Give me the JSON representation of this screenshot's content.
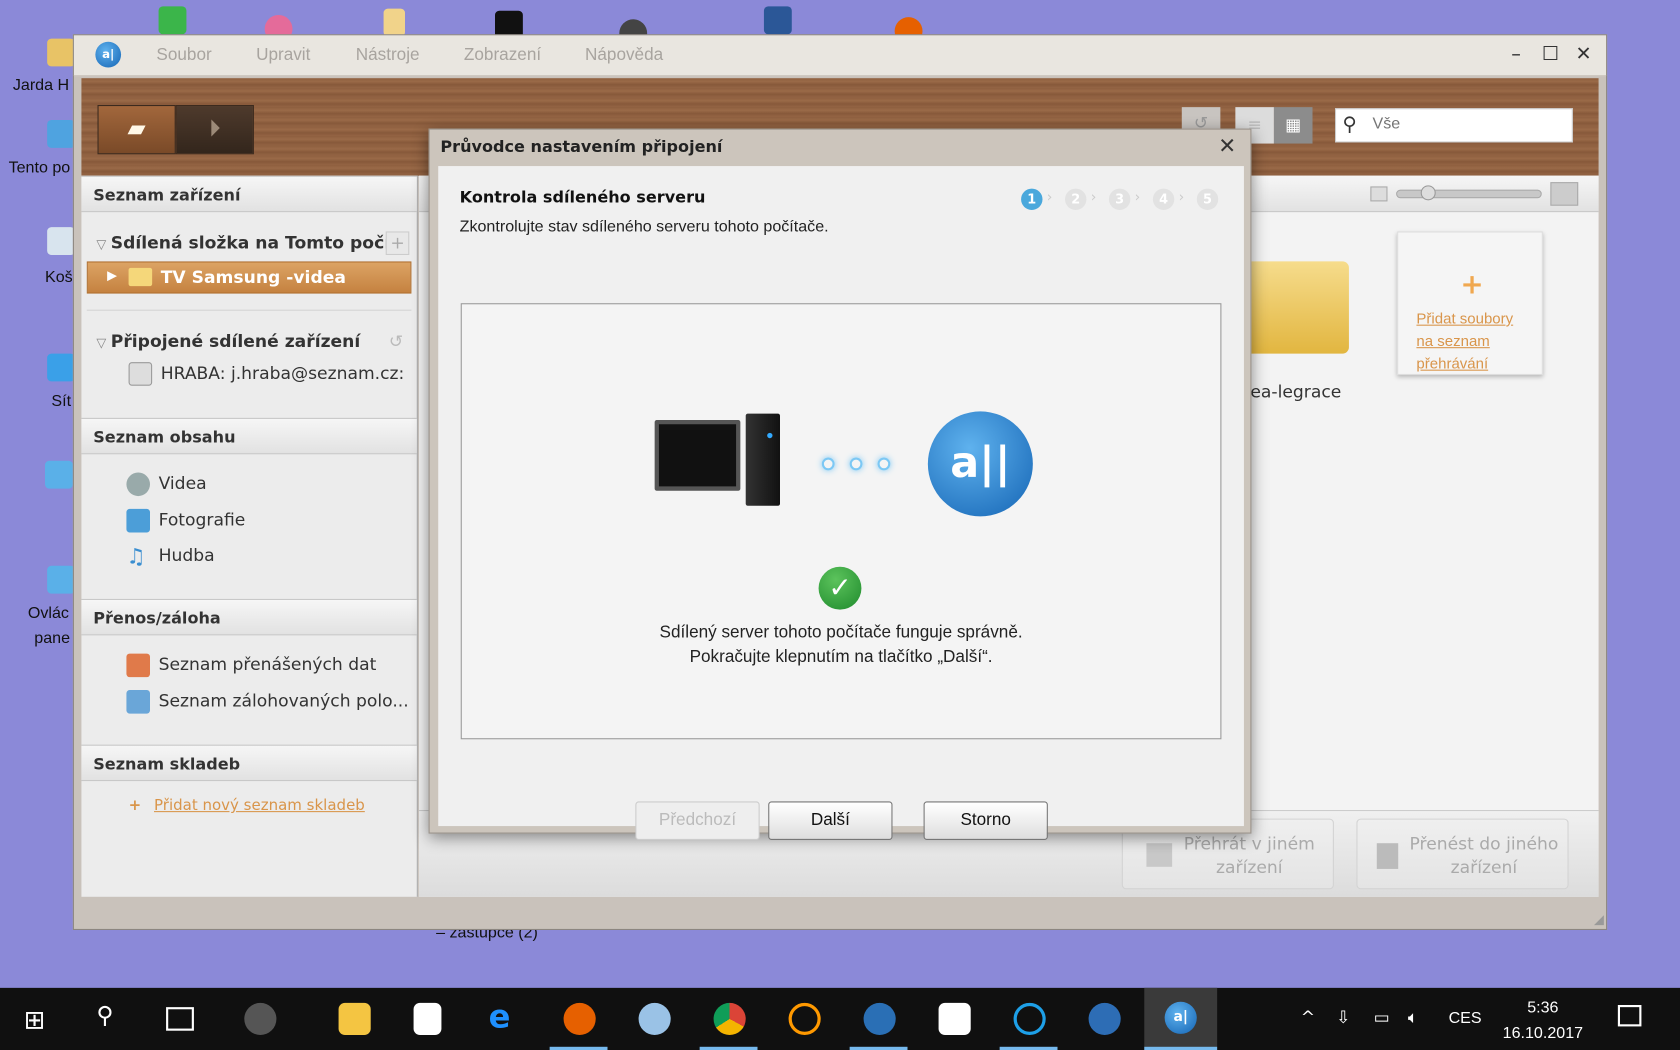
{
  "desktop": {
    "icons": [
      "Jarda H",
      "Tento po",
      "Koš",
      "Sít",
      "Ovlác",
      "pane"
    ],
    "partial_text": "– zástupce (2)"
  },
  "app": {
    "menu": [
      "Soubor",
      "Upravit",
      "Nástroje",
      "Zobrazení",
      "Nápověda"
    ],
    "search": {
      "placeholder": "Vše"
    },
    "sidebar": {
      "devices_header": "Seznam zařízení",
      "shared_folder": "Sdílená složka na Tomto počí...",
      "selected_item": "TV Samsung -videa",
      "connected": "Připojené sdílené zařízení",
      "connected_device": "HRABA: j.hraba@seznam.cz:",
      "content_header": "Seznam obsahu",
      "content_items": [
        "Videa",
        "Fotografie",
        "Hudba"
      ],
      "transfer_header": "Přenos/záloha",
      "transfer_items": [
        "Seznam přenášených dat",
        "Seznam zálohovaných polo..."
      ],
      "playlist_header": "Seznam skladeb",
      "add_playlist": "Přidat nový seznam skladeb"
    },
    "main": {
      "folder_label": "ea-legrace",
      "add_card": [
        "Přidat soubory",
        "na seznam",
        "přehrávání"
      ],
      "play_other": [
        "Přehrát v jiném",
        "zařízení"
      ],
      "send_other": [
        "Přenést do jiného",
        "zařízení"
      ]
    }
  },
  "dialog": {
    "title": "Průvodce nastavením připojení",
    "heading": "Kontrola sdíleného serveru",
    "subtitle": "Zkontrolujte stav sdíleného serveru tohoto počítače.",
    "steps": [
      "1",
      "2",
      "3",
      "4",
      "5"
    ],
    "current_step": 1,
    "status_line1": "Sdílený server tohoto počítače funguje správně.",
    "status_line2": "Pokračujte klepnutím na tlačítko „Další“.",
    "buttons": {
      "prev": "Předchozí",
      "next": "Další",
      "cancel": "Storno"
    }
  },
  "taskbar": {
    "language": "CES",
    "time": "5:36",
    "date": "16.10.2017"
  },
  "colors": {
    "accent": "#d9954a",
    "step_active": "#4aa8dc",
    "desktop": "#8b89d8"
  }
}
